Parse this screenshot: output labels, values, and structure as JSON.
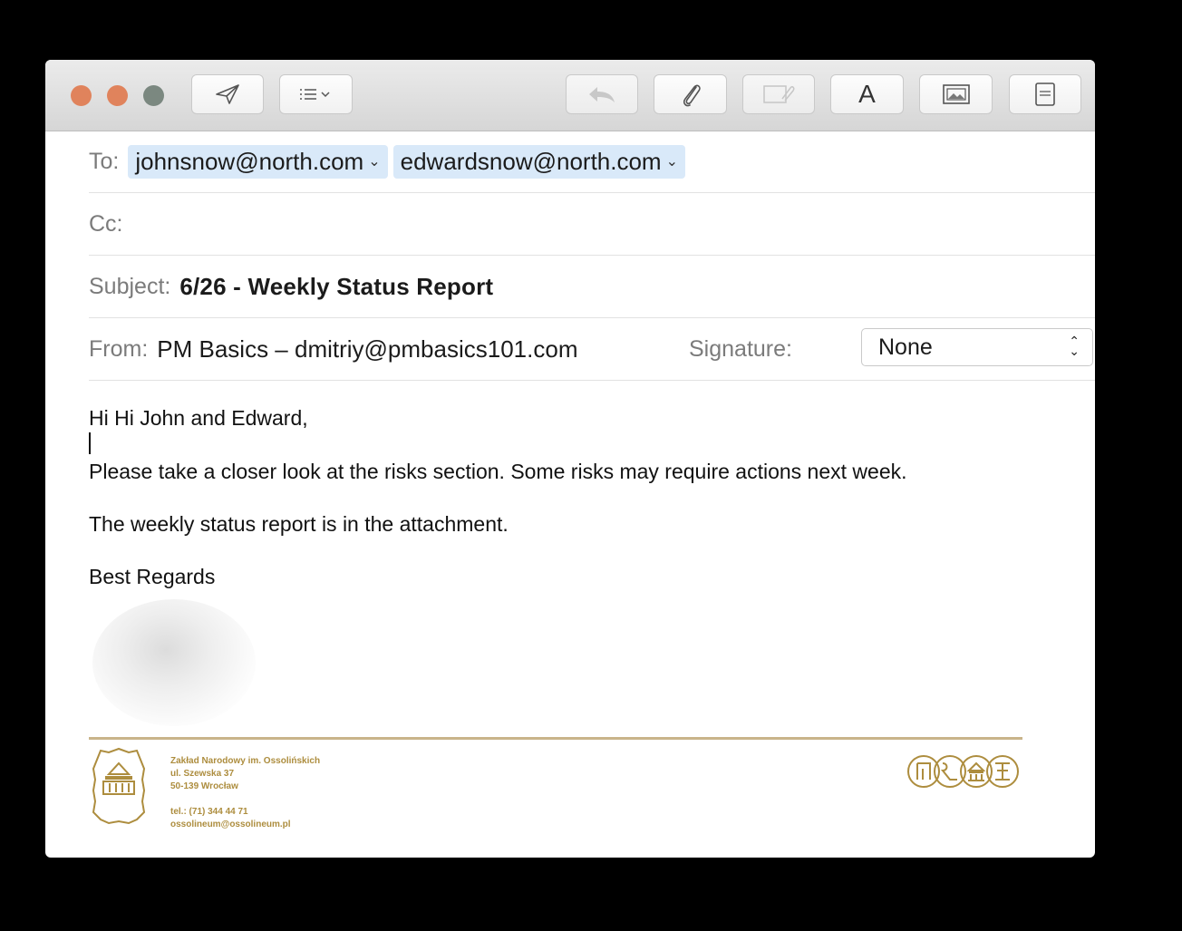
{
  "toolbar": {
    "traffic_lights": [
      {
        "name": "close",
        "color": "#e0835c"
      },
      {
        "name": "minimize",
        "color": "#e0835c"
      },
      {
        "name": "zoom",
        "color": "#7b8880"
      }
    ],
    "buttons": [
      {
        "name": "send-icon",
        "enabled": true
      },
      {
        "name": "header-fields-icon",
        "enabled": true
      },
      {
        "name": "reply-icon",
        "enabled": false
      },
      {
        "name": "paperclip-icon",
        "enabled": true
      },
      {
        "name": "markup-icon",
        "enabled": false
      },
      {
        "name": "format-icon",
        "label": "A",
        "enabled": true
      },
      {
        "name": "photo-browser-icon",
        "enabled": true
      },
      {
        "name": "stationery-icon",
        "enabled": true
      }
    ]
  },
  "header": {
    "to_label": "To:",
    "recipients": [
      "johnsnow@north.com",
      "edwardsnow@north.com"
    ],
    "cc_label": "Cc:",
    "subject_label": "Subject:",
    "subject": "6/26 - Weekly Status Report",
    "from_label": "From:",
    "from": "PM Basics – dmitriy@pmbasics101.com",
    "signature_label": "Signature:",
    "signature_value": "None"
  },
  "message": {
    "greeting": "Hi Hi John and Edward,",
    "paragraph1": "Please take a closer look at the risks section. Some risks may require actions next week.",
    "paragraph2": "The weekly status report is in the attachment.",
    "closing": "Best Regards"
  },
  "footer": {
    "org_name": "Zakład Narodowy im. Ossolińskich",
    "street": "ul. Szewska 37",
    "city": "50-139 Wrocław",
    "phone": "tel.: (71) 344 44 71",
    "email": "ossolineum@ossolineum.pl",
    "accent_color": "#ad8d3e"
  }
}
